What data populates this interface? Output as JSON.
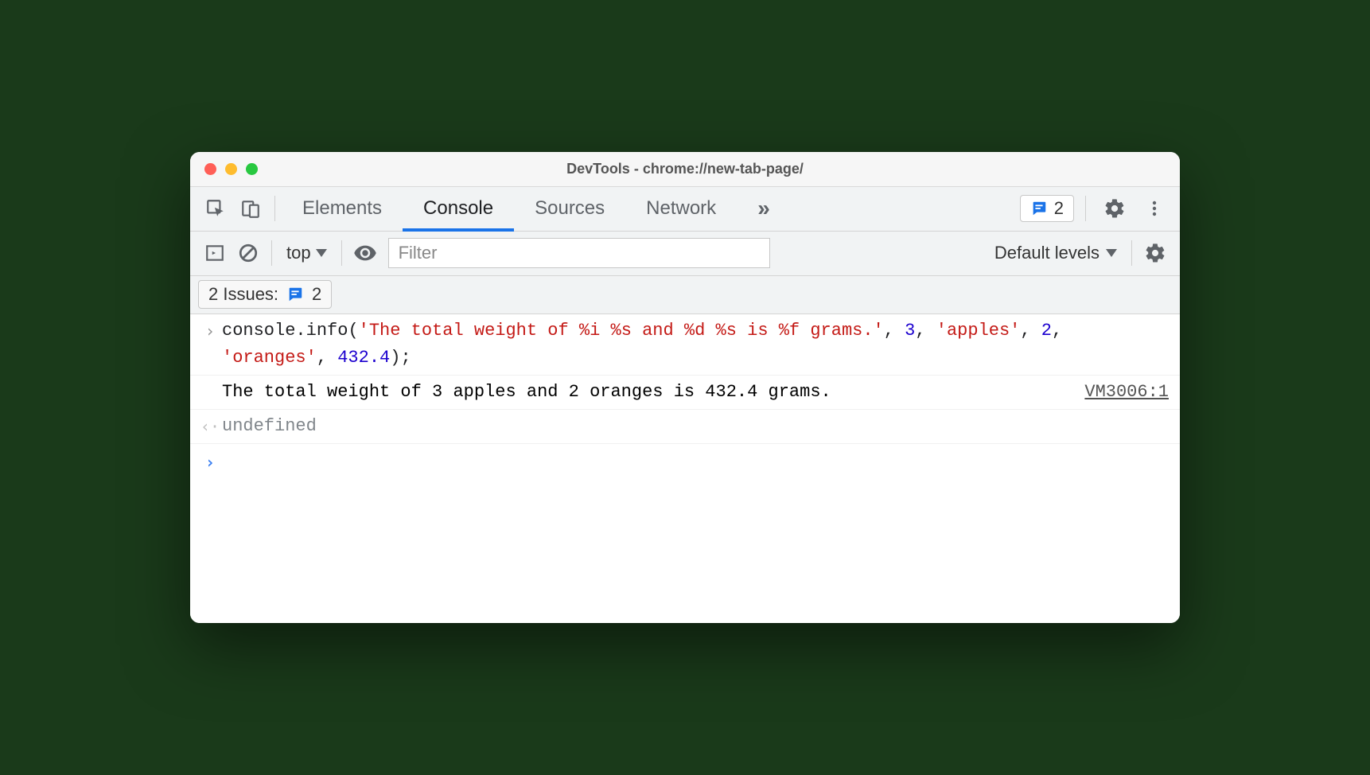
{
  "window": {
    "title": "DevTools - chrome://new-tab-page/"
  },
  "tabs": {
    "items": [
      "Elements",
      "Console",
      "Sources",
      "Network"
    ],
    "active_index": 1,
    "overflow_glyph": "»"
  },
  "header_issues": {
    "count": "2"
  },
  "toolbar": {
    "context": "top",
    "filter_placeholder": "Filter",
    "levels_label": "Default levels"
  },
  "issues_bar": {
    "label": "2 Issues:",
    "count": "2"
  },
  "console": {
    "input_tokens": [
      {
        "t": "obj",
        "v": "console"
      },
      {
        "t": "punct",
        "v": "."
      },
      {
        "t": "obj",
        "v": "info"
      },
      {
        "t": "punct",
        "v": "("
      },
      {
        "t": "str",
        "v": "'The total weight of %i %s and %d %s is %f grams.'"
      },
      {
        "t": "punct",
        "v": ", "
      },
      {
        "t": "num",
        "v": "3"
      },
      {
        "t": "punct",
        "v": ", "
      },
      {
        "t": "str",
        "v": "'apples'"
      },
      {
        "t": "punct",
        "v": ", "
      },
      {
        "t": "num",
        "v": "2"
      },
      {
        "t": "punct",
        "v": ", "
      },
      {
        "t": "str",
        "v": "'oranges'"
      },
      {
        "t": "punct",
        "v": ", "
      },
      {
        "t": "num",
        "v": "432.4"
      },
      {
        "t": "punct",
        "v": ");"
      }
    ],
    "output_text": "The total weight of 3 apples and 2 oranges is 432.4 grams.",
    "output_source": "VM3006:1",
    "return_value": "undefined"
  }
}
